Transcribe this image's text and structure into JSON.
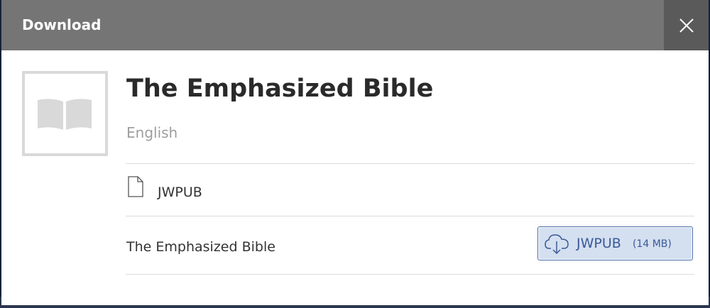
{
  "dialog": {
    "title": "Download",
    "close_icon": "close-icon"
  },
  "publication": {
    "thumbnail_icon": "open-book-icon",
    "title": "The Emphasized Bible",
    "language": "English"
  },
  "format_section": {
    "icon": "file-icon",
    "label": "JWPUB"
  },
  "items": [
    {
      "title": "The Emphasized Bible",
      "download": {
        "icon": "cloud-download-icon",
        "format": "JWPUB",
        "size": "(14 MB)"
      }
    }
  ],
  "colors": {
    "header_bg": "#757575",
    "close_bg": "#5a5a5a",
    "button_bg": "#d4dff0",
    "button_border": "#4a6da7",
    "button_text": "#3a5a98"
  }
}
